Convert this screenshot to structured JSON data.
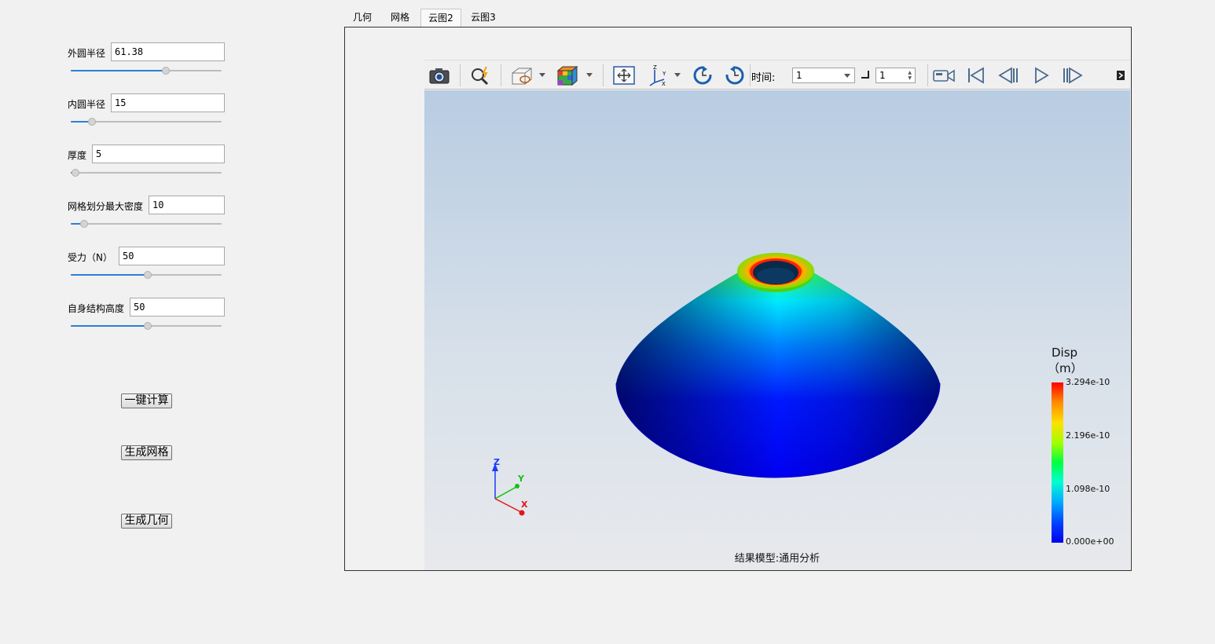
{
  "params": {
    "outer_radius": {
      "label": "外圆半径",
      "value": "61.38",
      "slider_fraction": 0.63
    },
    "inner_radius": {
      "label": "内圆半径",
      "value": "15",
      "slider_fraction": 0.14
    },
    "thickness": {
      "label": "厚度",
      "value": "5",
      "slider_fraction": 0.03
    },
    "mesh_density": {
      "label": "网格划分最大密度",
      "value": "10",
      "slider_fraction": 0.09
    },
    "force": {
      "label": "受力（N）",
      "value": "50",
      "slider_fraction": 0.51
    },
    "self_height": {
      "label": "自身结构高度",
      "value": "50",
      "slider_fraction": 0.51
    }
  },
  "buttons": {
    "compute": "一键计算",
    "gen_mesh": "生成网格",
    "gen_geometry": "生成几何"
  },
  "tabs": [
    {
      "label": "几何",
      "active": false
    },
    {
      "label": "网格",
      "active": false
    },
    {
      "label": "云图2",
      "active": true
    },
    {
      "label": "云图3",
      "active": false
    }
  ],
  "toolbar": {
    "time_label": "时间:",
    "time_value": "1",
    "step_value": "1",
    "icons": [
      "camera-icon",
      "zoom-icon",
      "display-mode-icon",
      "color-cube-icon",
      "fit-view-icon",
      "axes-icon",
      "rotate-cw-icon",
      "rotate-ccw-icon",
      "record-icon",
      "first-frame-icon",
      "prev-frame-icon",
      "play-icon",
      "next-frame-icon"
    ]
  },
  "viewport": {
    "caption": "结果模型:通用分析",
    "axes": {
      "z": "Z",
      "y": "Y",
      "x": "X"
    }
  },
  "legend": {
    "title": "Disp",
    "unit": "（m）",
    "ticks": [
      "3.294e-10",
      "2.196e-10",
      "1.098e-10",
      "0.000e+00"
    ]
  },
  "colors": {
    "bg": "#f1f1f1",
    "slider_fill": "#2a7fd4",
    "cone_low": "#0000ff",
    "cone_high": "#ff0000"
  }
}
